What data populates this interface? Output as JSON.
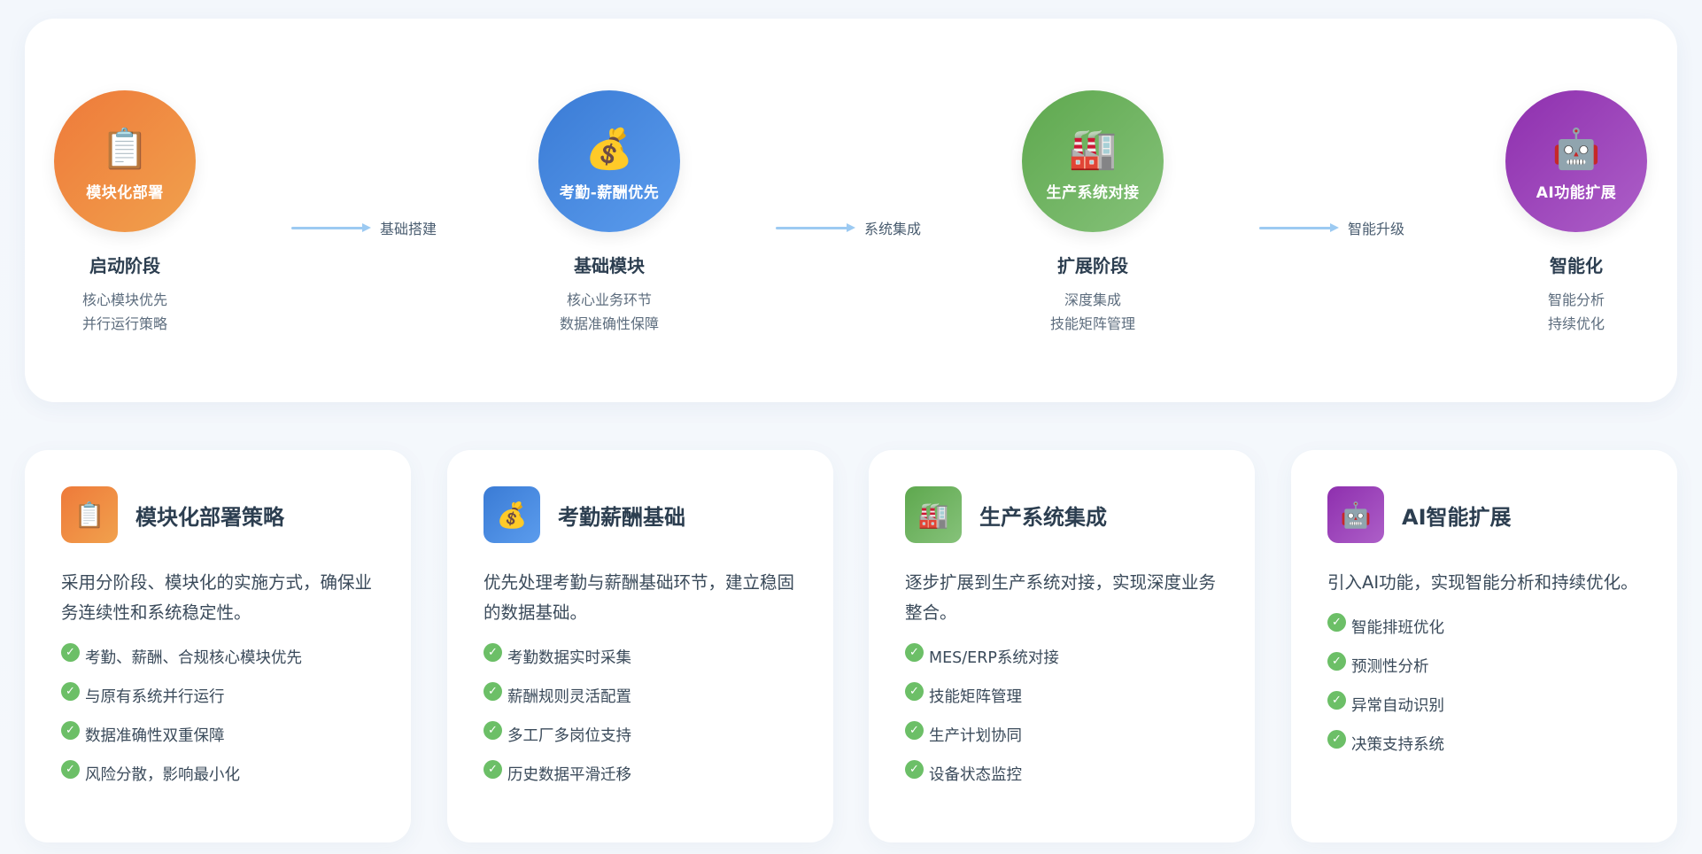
{
  "timeline": {
    "stages": [
      {
        "circle_label": "模块化部署",
        "title": "启动阶段",
        "lines": [
          "核心模块优先",
          "并行运行策略"
        ],
        "icon": "clipboard-icon",
        "glyph": "📋"
      },
      {
        "circle_label": "考勤-薪酬优先",
        "title": "基础模块",
        "lines": [
          "核心业务环节",
          "数据准确性保障"
        ],
        "icon": "money-bag-icon",
        "glyph": "💰"
      },
      {
        "circle_label": "生产系统对接",
        "title": "扩展阶段",
        "lines": [
          "深度集成",
          "技能矩阵管理"
        ],
        "icon": "factory-icon",
        "glyph": "🏭"
      },
      {
        "circle_label": "AI功能扩展",
        "title": "智能化",
        "lines": [
          "智能分析",
          "持续优化"
        ],
        "icon": "robot-icon",
        "glyph": "🤖"
      }
    ],
    "connectors": [
      "基础搭建",
      "系统集成",
      "智能升级"
    ]
  },
  "cards": [
    {
      "title": "模块化部署策略",
      "icon": "clipboard-icon",
      "glyph": "📋",
      "desc": "采用分阶段、模块化的实施方式，确保业务连续性和系统稳定性。",
      "items": [
        "考勤、薪酬、合规核心模块优先",
        "与原有系统并行运行",
        "数据准确性双重保障",
        "风险分散，影响最小化"
      ]
    },
    {
      "title": "考勤薪酬基础",
      "icon": "money-bag-icon",
      "glyph": "💰",
      "desc": "优先处理考勤与薪酬基础环节，建立稳固的数据基础。",
      "items": [
        "考勤数据实时采集",
        "薪酬规则灵活配置",
        "多工厂多岗位支持",
        "历史数据平滑迁移"
      ]
    },
    {
      "title": "生产系统集成",
      "icon": "factory-icon",
      "glyph": "🏭",
      "desc": "逐步扩展到生产系统对接，实现深度业务整合。",
      "items": [
        "MES/ERP系统对接",
        "技能矩阵管理",
        "生产计划协同",
        "设备状态监控"
      ]
    },
    {
      "title": "AI智能扩展",
      "icon": "robot-icon",
      "glyph": "🤖",
      "desc": "引入AI功能，实现智能分析和持续优化。",
      "items": [
        "智能排班优化",
        "预测性分析",
        "异常自动识别",
        "决策支持系统"
      ]
    }
  ],
  "colors": {
    "orange": "#ee7a3a",
    "blue": "#3a7bd5",
    "green": "#5ea84e",
    "purple": "#8e2fae",
    "check": "#6cbf67",
    "connector": "#9ccaf2"
  },
  "check_icon": "check-circle-icon",
  "check_glyph": "✓"
}
